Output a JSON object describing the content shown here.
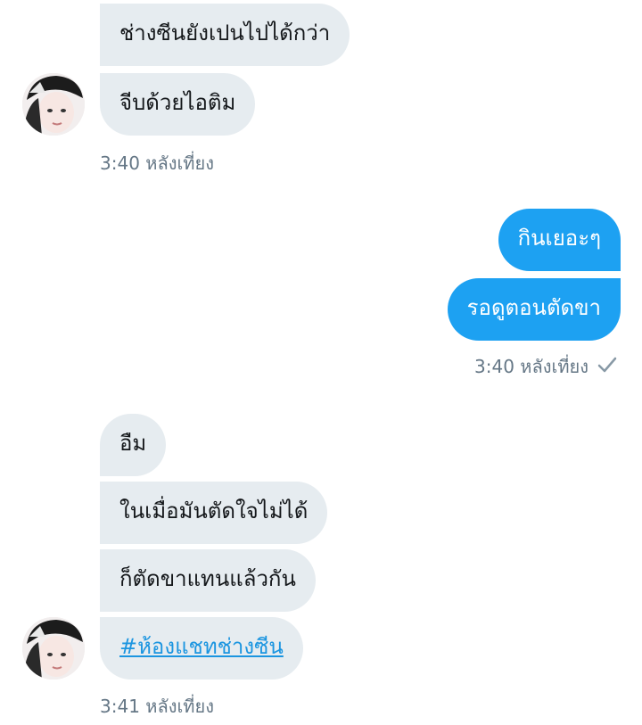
{
  "thread": {
    "group1": {
      "messages": [
        {
          "text": "ช่างซีนยังเปนไปได้กว่า"
        },
        {
          "text": "จีบด้วยไอติม"
        }
      ],
      "timestamp": "3:40 หลังเที่ยง"
    },
    "group2": {
      "messages": [
        {
          "text": "กินเยอะๆ"
        },
        {
          "text": "รอดูตอนตัดขา"
        }
      ],
      "timestamp": "3:40 หลังเที่ยง",
      "status_icon": "checkmark-icon"
    },
    "group3": {
      "messages": [
        {
          "text": "อืม"
        },
        {
          "text": "ในเมื่อมันตัดใจไม่ได้"
        },
        {
          "text": "ก็ตัดขาแทนแล้วกัน"
        },
        {
          "text": "#ห้องแชทช่างซีน"
        }
      ],
      "timestamp": "3:41 หลังเที่ยง"
    }
  },
  "colors": {
    "incoming_bubble": "#e6ecf0",
    "outgoing_bubble": "#1da1f2",
    "timestamp": "#657786",
    "hashtag": "#1b95e0"
  }
}
